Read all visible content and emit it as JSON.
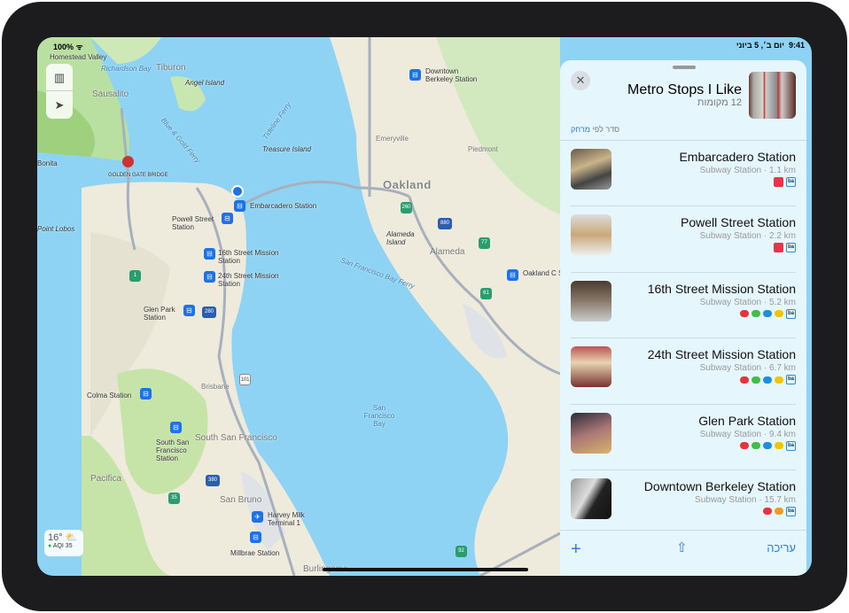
{
  "status": {
    "battery": "100%",
    "time": "9:41",
    "date": "יום ב׳, 5 ביוני"
  },
  "map": {
    "labels": {
      "homestead": "Homestead Valley",
      "richardson": "Richardson Bay",
      "tiburon": "Tiburon",
      "angel": "Angel Island",
      "sausalito": "Sausalito",
      "tideline": "Tideline Ferry",
      "bluegold": "Blue & Gold Ferry",
      "treasure": "Treasure Island",
      "bonita": "Bonita",
      "ggb": "GOLDEN GATE BRIDGE",
      "lobos": "Point Lobos",
      "oakland": "Oakland",
      "emeryville": "Emeryville",
      "piedmont": "Piedmont",
      "alamedaIsland": "Alameda Island",
      "alameda": "Alameda",
      "sfbayferry": "San Francisco Bay Ferry",
      "sfbay": "San Francisco Bay",
      "brisbane": "Brisbane",
      "ssf": "South San Francisco",
      "pacifica": "Pacifica",
      "sanbruno": "San Bruno",
      "burlingame": "Burlingame"
    },
    "stations": {
      "embarcadero": "Embarcadero Station",
      "powell": "Powell Street Station",
      "s16": "16th Street Mission Station",
      "s24": "24th Street Mission Station",
      "glen": "Glen Park Station",
      "colma": "Colma Station",
      "ssfs": "South San Francisco Station",
      "millbrae": "Millbrae Station",
      "harvey": "Harvey Milk Terminal 1",
      "berkeley": "Downtown Berkeley Station",
      "oaklandc": "Oakland C Station"
    },
    "shields": {
      "r1": "1",
      "r101": "101",
      "r280": "280",
      "r380": "380",
      "r35": "35",
      "r260": "260",
      "r880": "880",
      "r77": "77",
      "r61": "61",
      "r92": "92"
    },
    "weather": {
      "temp": "16°",
      "aqi": "AQI 35",
      "icon": "partly-sunny-icon"
    },
    "controls": {
      "map_icon": "map-icon",
      "location_icon": "location-arrow-icon"
    }
  },
  "panel": {
    "title": "Metro Stops I Like",
    "count": "12 מקומות",
    "sort_prefix": "סדר לפי ",
    "sort_value": "מרחק",
    "items": [
      {
        "name": "Embarcadero Station",
        "sub": "Subway Station · 1.1 km",
        "lines": [
          "muni",
          "bart"
        ]
      },
      {
        "name": "Powell Street Station",
        "sub": "Subway Station · 2.2 km",
        "lines": [
          "muni",
          "bart"
        ]
      },
      {
        "name": "16th Street Mission Station",
        "sub": "Subway Station · 5.2 km",
        "lines": [
          "#e8333a",
          "#3fbf45",
          "#1e8fe0",
          "#f5c400",
          "bart"
        ]
      },
      {
        "name": "24th Street Mission Station",
        "sub": "Subway Station · 6.7 km",
        "lines": [
          "#e8333a",
          "#3fbf45",
          "#1e8fe0",
          "#f5c400",
          "bart"
        ]
      },
      {
        "name": "Glen Park Station",
        "sub": "Subway Station · 9.4 km",
        "lines": [
          "#e8333a",
          "#3fbf45",
          "#1e8fe0",
          "#f5c400",
          "bart"
        ]
      },
      {
        "name": "Downtown Berkeley Station",
        "sub": "Subway Station · 15.7 km",
        "lines": [
          "#e8333a",
          "#f39a1e",
          "bart"
        ]
      }
    ],
    "bart_label": "ba",
    "footer": {
      "add": "+",
      "edit": "עריכה"
    }
  },
  "colors": {
    "accent": "#2f7ae5",
    "water": "#8fd3f4",
    "panel": "#e6f6fd"
  }
}
